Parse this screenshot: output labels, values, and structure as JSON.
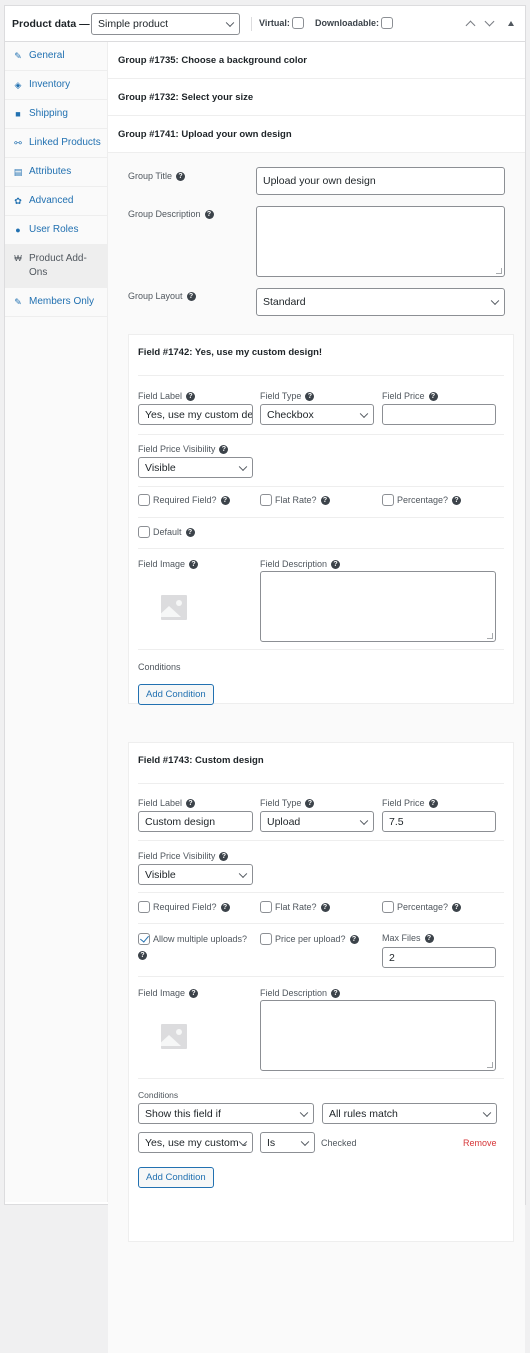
{
  "header": {
    "title": "Product data —",
    "product_type": "Simple product",
    "virtual_label": "Virtual:",
    "virtual_checked": false,
    "downloadable_label": "Downloadable:",
    "downloadable_checked": false
  },
  "sidebar": {
    "items": [
      {
        "label": "General",
        "icon": "wrench-icon",
        "glyph": "✎"
      },
      {
        "label": "Inventory",
        "icon": "tag-icon",
        "glyph": "◈"
      },
      {
        "label": "Shipping",
        "icon": "truck-icon",
        "glyph": "■"
      },
      {
        "label": "Linked Products",
        "icon": "link-icon",
        "glyph": "⚯"
      },
      {
        "label": "Attributes",
        "icon": "list-icon",
        "glyph": "▤"
      },
      {
        "label": "Advanced",
        "icon": "gear-icon",
        "glyph": "✿"
      },
      {
        "label": "User Roles",
        "icon": "user-icon",
        "glyph": "●"
      },
      {
        "label": "Product Add-Ons",
        "icon": "cart-icon",
        "glyph": "🛒",
        "active": true
      },
      {
        "label": "Members Only",
        "icon": "wrench-icon",
        "glyph": "✎"
      }
    ]
  },
  "groups": [
    {
      "title": "Group #1735: Choose a background color"
    },
    {
      "title": "Group #1732: Select your size"
    },
    {
      "title": "Group #1741: Upload your own design"
    }
  ],
  "group_form": {
    "title_label": "Group Title",
    "title_value": "Upload your own design",
    "description_label": "Group Description",
    "description_value": "",
    "layout_label": "Group Layout",
    "layout_value": "Standard"
  },
  "fields": [
    {
      "title": "Field #1742: Yes, use my custom design!",
      "label_label": "Field Label",
      "label_value": "Yes, use my custom des",
      "type_label": "Field Type",
      "type_value": "Checkbox",
      "price_label": "Field Price",
      "price_value": "",
      "visibility_label": "Field Price Visibility",
      "visibility_value": "Visible",
      "required_label": "Required Field?",
      "flat_rate_label": "Flat Rate?",
      "percentage_label": "Percentage?",
      "default_label": "Default",
      "image_label": "Field Image",
      "description_label": "Field Description",
      "conditions_label": "Conditions",
      "add_condition_label": "Add Condition"
    },
    {
      "title": "Field #1743: Custom design",
      "label_label": "Field Label",
      "label_value": "Custom design",
      "type_label": "Field Type",
      "type_value": "Upload",
      "price_label": "Field Price",
      "price_value": "7.5",
      "visibility_label": "Field Price Visibility",
      "visibility_value": "Visible",
      "required_label": "Required Field?",
      "flat_rate_label": "Flat Rate?",
      "percentage_label": "Percentage?",
      "multiple_uploads_label": "Allow multiple uploads?",
      "multiple_uploads_checked": true,
      "price_per_upload_label": "Price per upload?",
      "max_files_label": "Max Files",
      "max_files_value": "2",
      "image_label": "Field Image",
      "description_label": "Field Description",
      "conditions_label": "Conditions",
      "condition_action": "Show this field if",
      "condition_match": "All rules match",
      "rule": {
        "field": "Yes, use my custom c",
        "operator": "Is",
        "value": "Checked",
        "remove_label": "Remove"
      },
      "add_condition_label": "Add Condition"
    }
  ],
  "help_glyph": "?",
  "colors": {
    "link": "#2271b1",
    "remove": "#d63638",
    "text": "#3c434a"
  }
}
